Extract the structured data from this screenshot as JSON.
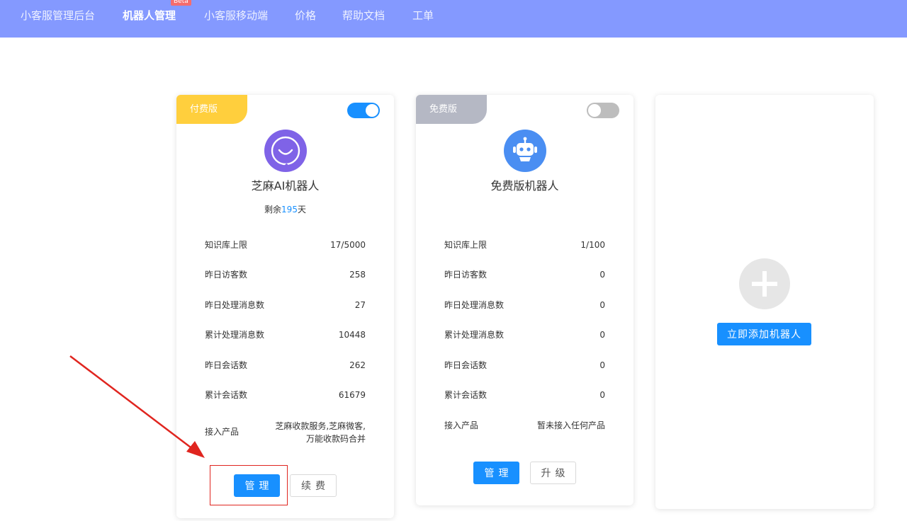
{
  "nav": {
    "items": [
      {
        "label": "小客服管理后台",
        "active": false
      },
      {
        "label": "机器人管理",
        "active": true,
        "badge": "Beta"
      },
      {
        "label": "小客服移动端",
        "active": false
      },
      {
        "label": "价格",
        "active": false
      },
      {
        "label": "帮助文档",
        "active": false
      },
      {
        "label": "工单",
        "active": false
      }
    ]
  },
  "colors": {
    "nav_bg": "#8499ff",
    "primary": "#1890ff",
    "paid_ribbon": "#ffcf3d",
    "free_ribbon": "#b5b8c4",
    "annotation": "#e0251f"
  },
  "cards": [
    {
      "tier": "付费版",
      "enabled": true,
      "avatar_icon": "smile-chat-icon",
      "name": "芝麻AI机器人",
      "remaining_prefix": "剩余",
      "remaining_days": "195",
      "remaining_suffix": "天",
      "stats": [
        {
          "label": "知识库上限",
          "value": "17/5000"
        },
        {
          "label": "昨日访客数",
          "value": "258"
        },
        {
          "label": "昨日处理消息数",
          "value": "27"
        },
        {
          "label": "累计处理消息数",
          "value": "10448"
        },
        {
          "label": "昨日会话数",
          "value": "262"
        },
        {
          "label": "累计会话数",
          "value": "61679"
        }
      ],
      "products_label": "接入产品",
      "products_line1": "芝麻收款服务,芝麻微客,",
      "products_line2": "万能收款码合并",
      "manage_label": "管理",
      "secondary_label": "续费"
    },
    {
      "tier": "免费版",
      "enabled": false,
      "avatar_icon": "robot-icon",
      "name": "免费版机器人",
      "stats": [
        {
          "label": "知识库上限",
          "value": "1/100"
        },
        {
          "label": "昨日访客数",
          "value": "0"
        },
        {
          "label": "昨日处理消息数",
          "value": "0"
        },
        {
          "label": "累计处理消息数",
          "value": "0"
        },
        {
          "label": "昨日会话数",
          "value": "0"
        },
        {
          "label": "累计会话数",
          "value": "0"
        }
      ],
      "products_label": "接入产品",
      "products_value": "暂未接入任何产品",
      "manage_label": "管理",
      "secondary_label": "升级"
    }
  ],
  "add_card": {
    "icon": "plus-icon",
    "button_label": "立即添加机器人"
  }
}
